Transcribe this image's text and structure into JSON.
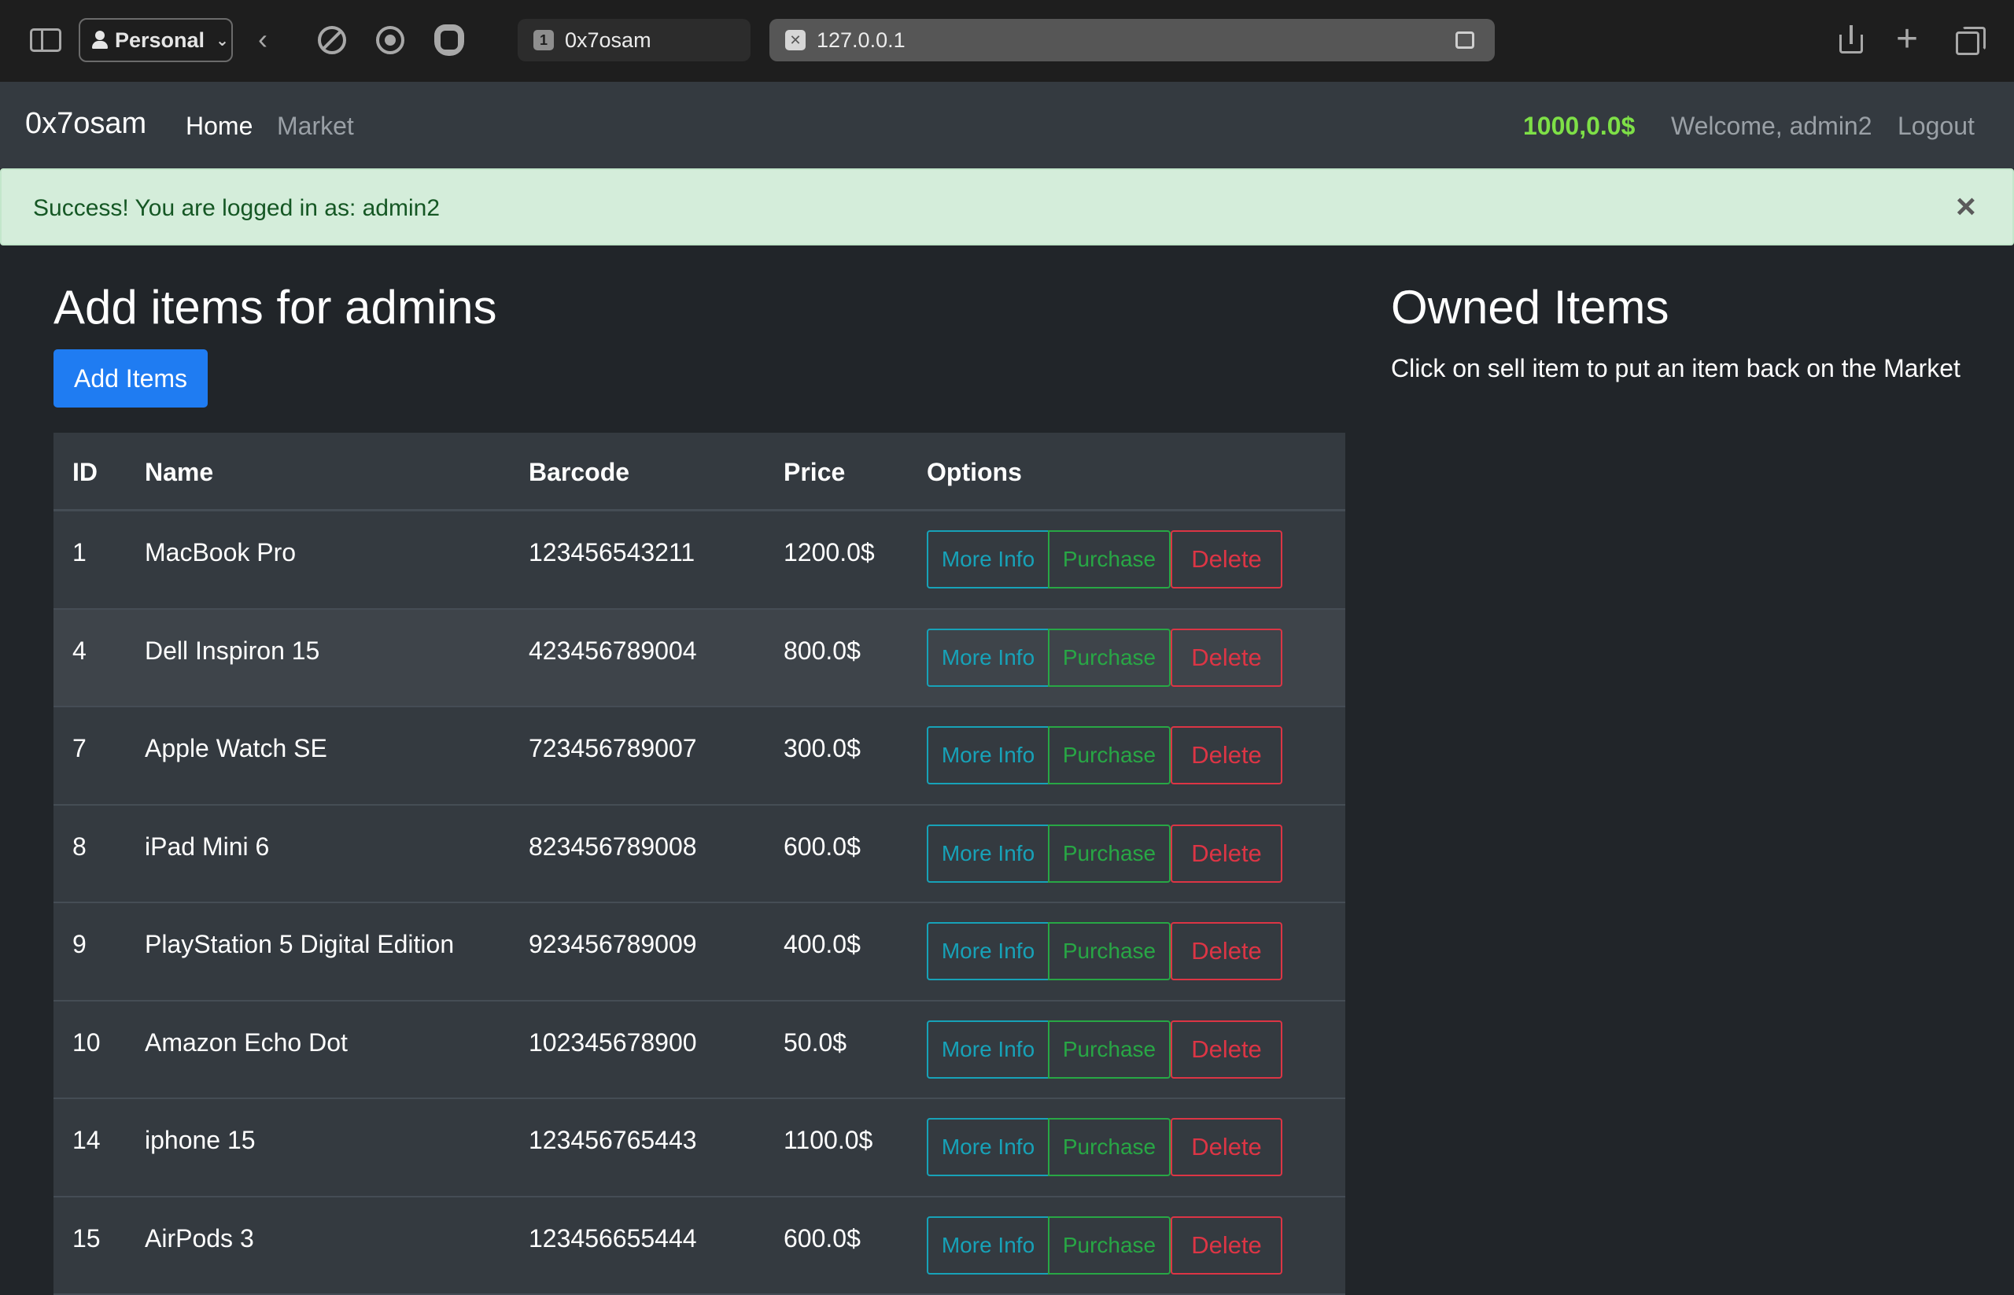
{
  "browser": {
    "profile_label": "Personal",
    "tabs": [
      {
        "favicon": "1",
        "title": "0x7osam"
      },
      {
        "favicon": "✕",
        "title": "127.0.0.1"
      }
    ]
  },
  "navbar": {
    "brand": "0x7osam",
    "links": [
      "Home",
      "Market"
    ],
    "budget": "1000,0.0$",
    "welcome": "Welcome, admin2",
    "logout": "Logout"
  },
  "alert": {
    "text": "Success! You are logged in as: admin2",
    "close": "×"
  },
  "left": {
    "title": "Add items for admins",
    "add_button": "Add Items"
  },
  "right": {
    "title": "Owned Items",
    "subtitle": "Click on sell item to put an item back on the Market"
  },
  "table": {
    "headers": [
      "ID",
      "Name",
      "Barcode",
      "Price",
      "Options"
    ],
    "button_labels": {
      "info": "More Info",
      "purchase": "Purchase",
      "delete": "Delete"
    },
    "rows": [
      {
        "id": "1",
        "name": "MacBook Pro",
        "barcode": "123456543211",
        "price": "1200.0$"
      },
      {
        "id": "4",
        "name": "Dell Inspiron 15",
        "barcode": "423456789004",
        "price": "800.0$"
      },
      {
        "id": "7",
        "name": "Apple Watch SE",
        "barcode": "723456789007",
        "price": "300.0$"
      },
      {
        "id": "8",
        "name": "iPad Mini 6",
        "barcode": "823456789008",
        "price": "600.0$"
      },
      {
        "id": "9",
        "name": "PlayStation 5 Digital Edition",
        "barcode": "923456789009",
        "price": "400.0$"
      },
      {
        "id": "10",
        "name": "Amazon Echo Dot",
        "barcode": "102345678900",
        "price": "50.0$"
      },
      {
        "id": "14",
        "name": "iphone 15",
        "barcode": "123456765443",
        "price": "1100.0$"
      },
      {
        "id": "15",
        "name": "AirPods 3",
        "barcode": "123456655444",
        "price": "600.0$"
      }
    ]
  }
}
